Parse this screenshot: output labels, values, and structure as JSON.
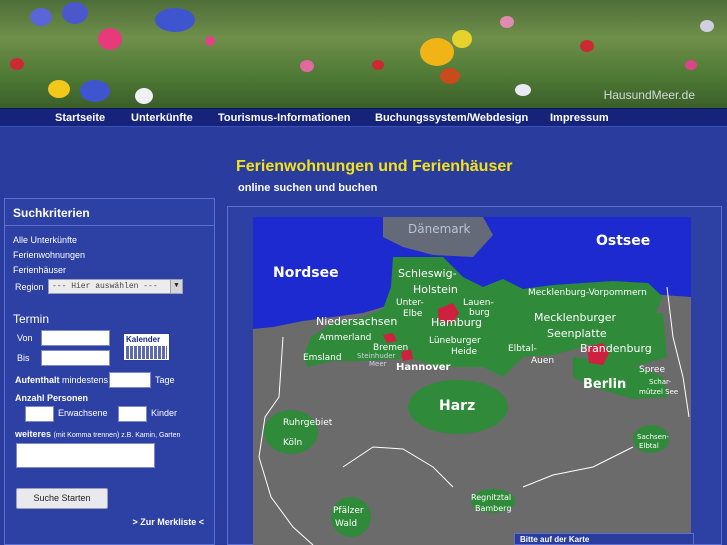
{
  "brand": "HausundMeer.de",
  "nav": [
    "Startseite",
    "Unterkünfte",
    "Tourismus-Informationen",
    "Buchungssystem/Webdesign",
    "Impressum"
  ],
  "title": "Ferienwohnungen und Ferienhäuser",
  "subtitle": "online suchen und buchen",
  "search": {
    "header": "Suchkriterien",
    "links": [
      "Alle Unterkünfte",
      "Ferienwohnungen",
      "Ferienhäuser"
    ],
    "region_label": "Region",
    "region_value": "--- Hier auswählen ---",
    "termin_label": "Termin",
    "von_label": "Von",
    "bis_label": "Bis",
    "kalender": "Kalender",
    "aufenthalt_bold": "Aufenthalt",
    "aufenthalt_rest": "mindestens",
    "tage": "Tage",
    "personen_label": "Anzahl Personen",
    "erwachsene": "Erwachsene",
    "kinder": "Kinder",
    "weiteres_bold": "weiteres",
    "weiteres_hint": "(mit Komma trennen) z.B. Kamin, Garten",
    "submit": "Suche Starten",
    "merkliste": "> Zur Merkliste <"
  },
  "map": {
    "hint": "Bitte auf der Karte",
    "labels": {
      "daenemark": "Dänemark",
      "ostsee": "Ostsee",
      "nordsee": "Nordsee",
      "schleswig": "Schleswig-",
      "holstein": "Holstein",
      "mecklenburg_vp": "Mecklenburg-Vorpommern",
      "unterelbe1": "Unter-",
      "unterelbe2": "Elbe",
      "lauenburg1": "Lauen-",
      "lauenburg2": "burg",
      "niedersachsen": "Niedersachsen",
      "hamburg": "Hamburg",
      "mecklenburger1": "Mecklenburger",
      "mecklenburger2": "Seenplatte",
      "ammerland": "Ammerland",
      "bremen": "Bremen",
      "steinhuder1": "Steinhuder",
      "steinhuder2": "Meer",
      "lueneburger1": "Lüneburger",
      "lueneburger2": "Heide",
      "elbtal1": "Elbtal-",
      "elbtal2": "Auen",
      "brandenburg": "Brandenburg",
      "emsland": "Emsland",
      "hannover": "Hannover",
      "berlin": "Berlin",
      "spree": "Spree",
      "scharm1": "Schar-",
      "scharm2": "mützel See",
      "harz": "Harz",
      "ruhrgebiet": "Ruhrgebiet",
      "koeln": "Köln",
      "sachsen1": "Sachsen-",
      "sachsen2": "Elbtal",
      "regnitz1": "Regnitztal",
      "regnitz2": "Bamberg",
      "pfaelzer1": "Pfälzer",
      "pfaelzer2": "Wald"
    }
  },
  "colors": {
    "page_bg": "#2a3d9e",
    "nav_bg": "#16237a",
    "title": "#f3e21c",
    "sea": "#1c2ad0",
    "land": "#6b6b6b",
    "region": "#2f8a3a",
    "city": "#d02040"
  }
}
